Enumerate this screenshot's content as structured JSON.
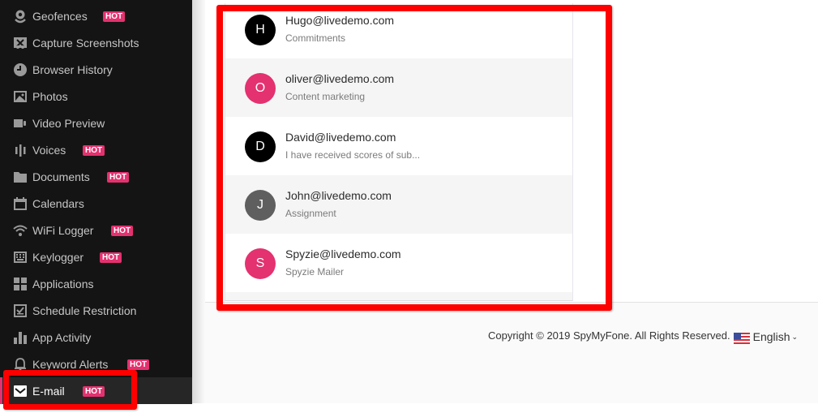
{
  "sidebar": {
    "items": [
      {
        "label": "Geofences",
        "icon": "map-pin-icon",
        "hot": true,
        "active": false
      },
      {
        "label": "Capture Screenshots",
        "icon": "screenshot-icon",
        "hot": false,
        "active": false
      },
      {
        "label": "Browser History",
        "icon": "clock-icon",
        "hot": false,
        "active": false
      },
      {
        "label": "Photos",
        "icon": "image-icon",
        "hot": false,
        "active": false
      },
      {
        "label": "Video Preview",
        "icon": "video-camera-icon",
        "hot": false,
        "active": false
      },
      {
        "label": "Voices",
        "icon": "audio-bars-icon",
        "hot": true,
        "active": false
      },
      {
        "label": "Documents",
        "icon": "folder-icon",
        "hot": true,
        "active": false
      },
      {
        "label": "Calendars",
        "icon": "calendar-icon",
        "hot": false,
        "active": false
      },
      {
        "label": "WiFi Logger",
        "icon": "wifi-icon",
        "hot": true,
        "active": false
      },
      {
        "label": "Keylogger",
        "icon": "keyboard-icon",
        "hot": true,
        "active": false
      },
      {
        "label": "Applications",
        "icon": "grid-icon",
        "hot": false,
        "active": false
      },
      {
        "label": "Schedule Restriction",
        "icon": "schedule-check-icon",
        "hot": false,
        "active": false
      },
      {
        "label": "App Activity",
        "icon": "bar-chart-icon",
        "hot": false,
        "active": false
      },
      {
        "label": "Keyword Alerts",
        "icon": "bell-icon",
        "hot": true,
        "active": false
      },
      {
        "label": "E-mail",
        "icon": "envelope-icon",
        "hot": true,
        "active": true
      }
    ],
    "hot_label": "HOT"
  },
  "emails": [
    {
      "initial": "H",
      "from": "Hugo@livedemo.com",
      "subject": "Commitments",
      "avatar_color": "#000000"
    },
    {
      "initial": "O",
      "from": "oliver@livedemo.com",
      "subject": "Content marketing",
      "avatar_color": "#e4316f"
    },
    {
      "initial": "D",
      "from": "David@livedemo.com",
      "subject": "I have received scores of sub...",
      "avatar_color": "#000000"
    },
    {
      "initial": "J",
      "from": "John@livedemo.com",
      "subject": "Assignment",
      "avatar_color": "#5f5f5f"
    },
    {
      "initial": "S",
      "from": "Spyzie@livedemo.com",
      "subject": "Spyzie Mailer",
      "avatar_color": "#e4316f"
    }
  ],
  "footer": {
    "copyright": "Copyright © 2019 SpyMyFone. All Rights Reserved.",
    "language": "English",
    "language_flag": "us-flag-icon"
  },
  "colors": {
    "accent": "#e4316f",
    "highlight": "#ff0000",
    "sidebar_bg": "#141414"
  }
}
